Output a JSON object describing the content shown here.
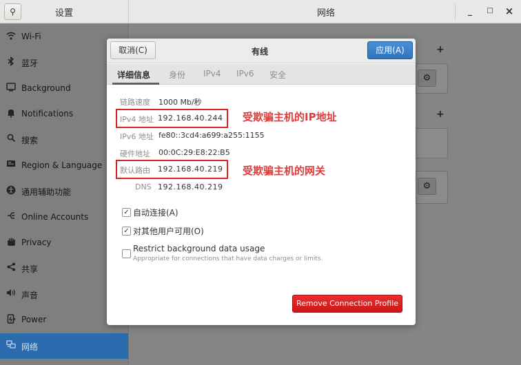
{
  "header": {
    "left_title": "设置",
    "title": "网络",
    "minimize": "_",
    "maximize": "□",
    "close": "×"
  },
  "sidebar": {
    "items": [
      {
        "label": "Wi-Fi",
        "icon": "wifi-icon"
      },
      {
        "label": "蓝牙",
        "icon": "bluetooth-icon"
      },
      {
        "label": "Background",
        "icon": "background-icon"
      },
      {
        "label": "Notifications",
        "icon": "bell-icon"
      },
      {
        "label": "搜索",
        "icon": "search-icon"
      },
      {
        "label": "Region & Language",
        "icon": "region-icon"
      },
      {
        "label": "通用辅助功能",
        "icon": "accessibility-icon"
      },
      {
        "label": "Online Accounts",
        "icon": "online-accounts-icon"
      },
      {
        "label": "Privacy",
        "icon": "hand-icon"
      },
      {
        "label": "共享",
        "icon": "share-icon"
      },
      {
        "label": "声音",
        "icon": "speaker-icon"
      },
      {
        "label": "Power",
        "icon": "power-icon"
      },
      {
        "label": "网络",
        "icon": "network-icon",
        "active": true
      }
    ]
  },
  "background": {
    "plus": "+",
    "gear": "⚙"
  },
  "dialog": {
    "cancel_label": "取消(C)",
    "title": "有线",
    "apply_label": "应用(A)",
    "tabs": [
      "详细信息",
      "身份",
      "IPv4",
      "IPv6",
      "安全"
    ],
    "details": {
      "link_speed_label": "链路速度",
      "link_speed_value": "1000 Mb/秒",
      "ipv4_label": "IPv4 地址",
      "ipv4_value": "192.168.40.244",
      "ipv6_label": "IPv6 地址",
      "ipv6_value": "fe80::3cd4:a699:a255:1155",
      "hw_label": "硬件地址",
      "hw_value": "00:0C:29:E8:22:B5",
      "route_label": "默认路由",
      "route_value": "192.168.40.219",
      "dns_label": "DNS",
      "dns_value": "192.168.40.219"
    },
    "annotations": {
      "ip": "受欺骗主机的IP地址",
      "gateway": "受欺骗主机的网关"
    },
    "auto_connect": {
      "label": "自动连接(A)",
      "checked": true
    },
    "all_users": {
      "label": "对其他用户可用(O)",
      "checked": true
    },
    "restrict": {
      "label": "Restrict background data usage",
      "sublabel": "Appropriate for connections that have data charges or limits.",
      "checked": false
    },
    "remove_label": "Remove Connection Profile"
  },
  "colors": {
    "apply": "#3b82cc",
    "remove": "#df2323",
    "annotation": "#e23a3a",
    "sidebar_active": "#2b6cae"
  }
}
